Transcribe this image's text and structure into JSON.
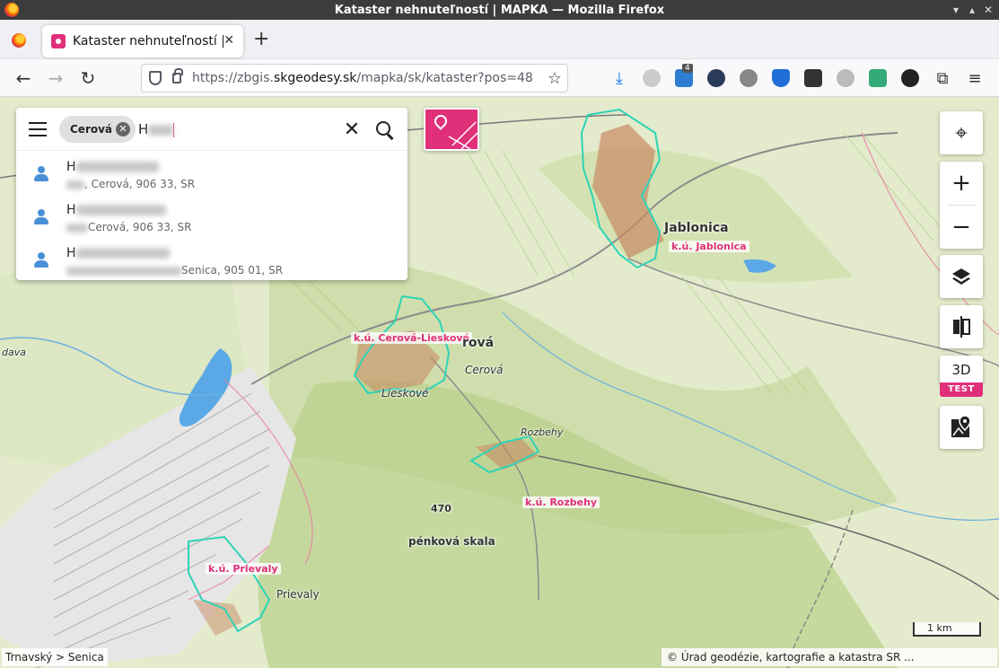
{
  "window": {
    "title": "Kataster nehnuteľností | MAPKA — Mozilla Firefox"
  },
  "tab": {
    "title": "Kataster nehnuteľností | MAPKA",
    "close": "✕",
    "new_tab": "+"
  },
  "nav": {
    "back": "←",
    "forward": "→",
    "reload": "↻",
    "url_prefix": "https://zbgis.",
    "url_domain": "skgeodesy.sk",
    "url_suffix": "/mapka/sk/kataster?pos=48",
    "bookmark": "☆",
    "ext_badge": "4"
  },
  "search": {
    "chip_label": "Cerová",
    "chip_remove": "✕",
    "query_prefix": "H",
    "clear": "✕",
    "results": [
      {
        "name_prefix": "H",
        "address": ", Cerová, 906 33, SR"
      },
      {
        "name_prefix": "H",
        "address": "Cerová, 906 33, SR"
      },
      {
        "name_prefix": "H",
        "address": "Senica, 905 01, SR"
      }
    ]
  },
  "controls": {
    "locate": "⌖",
    "zoom_in": "+",
    "zoom_out": "−",
    "layers": "layers-icon",
    "compare": "compare-icon",
    "btn_3d": "3D",
    "test_badge": "TEST",
    "geo_map": "map-pin-icon"
  },
  "map": {
    "labels_ku": {
      "jablonica": "k.ú. Jablonica",
      "cerova_lieskove": "k.ú. Cerová-Lieskové",
      "rozbehy": "k.ú. Rozbehy",
      "prievaly": "k.ú. Prievaly"
    },
    "places": {
      "jablonica": "Jablonica",
      "cerova_big": "rová",
      "cerova": "Cerová",
      "lieskove": "Lieskové",
      "rozbehy": "Rozbehy",
      "elevation": "470",
      "skala": "pénková skala",
      "prievaly": "Prievaly",
      "dava": "dava"
    },
    "scale": "1 km",
    "breadcrumb": "Trnavský > Senica",
    "copyright": "© Úrad geodézie, kartografie a katastra SR ..."
  },
  "colors": {
    "accent": "#e0307a",
    "cadastre_border": "#2ed3b7",
    "water": "#5aa9e6",
    "terrain": "#dfe8c8"
  }
}
